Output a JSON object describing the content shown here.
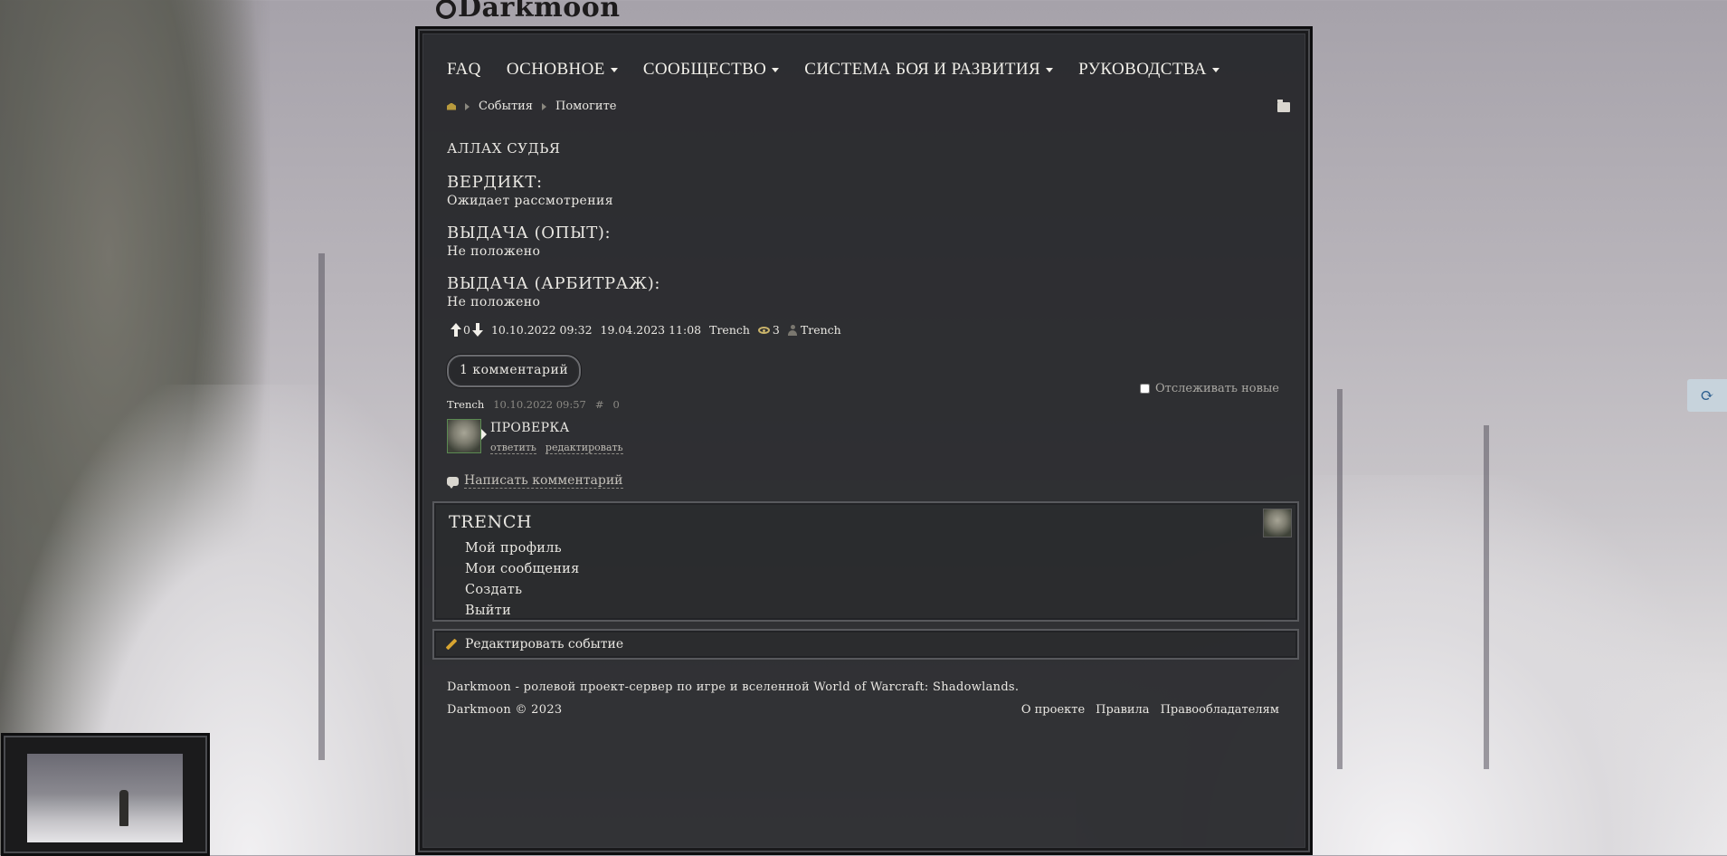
{
  "site": {
    "logo_text": "Darkmoon"
  },
  "nav": {
    "items": [
      {
        "label": "FAQ",
        "has_dropdown": false
      },
      {
        "label": "ОСНОВНОЕ",
        "has_dropdown": true
      },
      {
        "label": "СООБЩЕСТВО",
        "has_dropdown": true
      },
      {
        "label": "СИСТЕМА БОЯ И РАЗВИТИЯ",
        "has_dropdown": true
      },
      {
        "label": "РУКОВОДСТВА",
        "has_dropdown": true
      }
    ]
  },
  "breadcrumb": {
    "items": [
      "События",
      "Помогите"
    ]
  },
  "event": {
    "title": "аллах судья",
    "verdict_label": "Вердикт:",
    "verdict_value": "Ожидает рассмотрения",
    "exp_label": "Выдача (Опыт):",
    "exp_value": "Не положено",
    "arb_label": "Выдача (Арбитраж):",
    "arb_value": "Не положено"
  },
  "meta": {
    "rating": "0",
    "created": "10.10.2022 09:32",
    "updated": "19.04.2023 11:08",
    "author": "Trench",
    "views": "3",
    "editor": "Trench"
  },
  "comments": {
    "count_label": "1 комментарий",
    "track_label": "Отслеживать новые",
    "items": [
      {
        "author": "Trench",
        "date": "10.10.2022 09:57",
        "anchor": "#",
        "rating": "0",
        "text": "Проверка",
        "reply_label": "ответить",
        "edit_label": "редактировать"
      }
    ],
    "write_label": "Написать комментарий"
  },
  "userbox": {
    "name": "Trench",
    "links": [
      "Мой профиль",
      "Мои сообщения",
      "Создать",
      "Выйти"
    ]
  },
  "edit_event_label": "Редактировать событие",
  "footer": {
    "description": "Darkmoon - ролевой проект-сервер по игре и вселенной World of Warcraft: Shadowlands.",
    "copyright": "Darkmoon © 2023",
    "links": [
      "О проекте",
      "Правила",
      "Правообладателям"
    ]
  },
  "colors": {
    "panel_bg": "#222326",
    "text": "#e9e7e2",
    "accent": "#c9b36a"
  }
}
